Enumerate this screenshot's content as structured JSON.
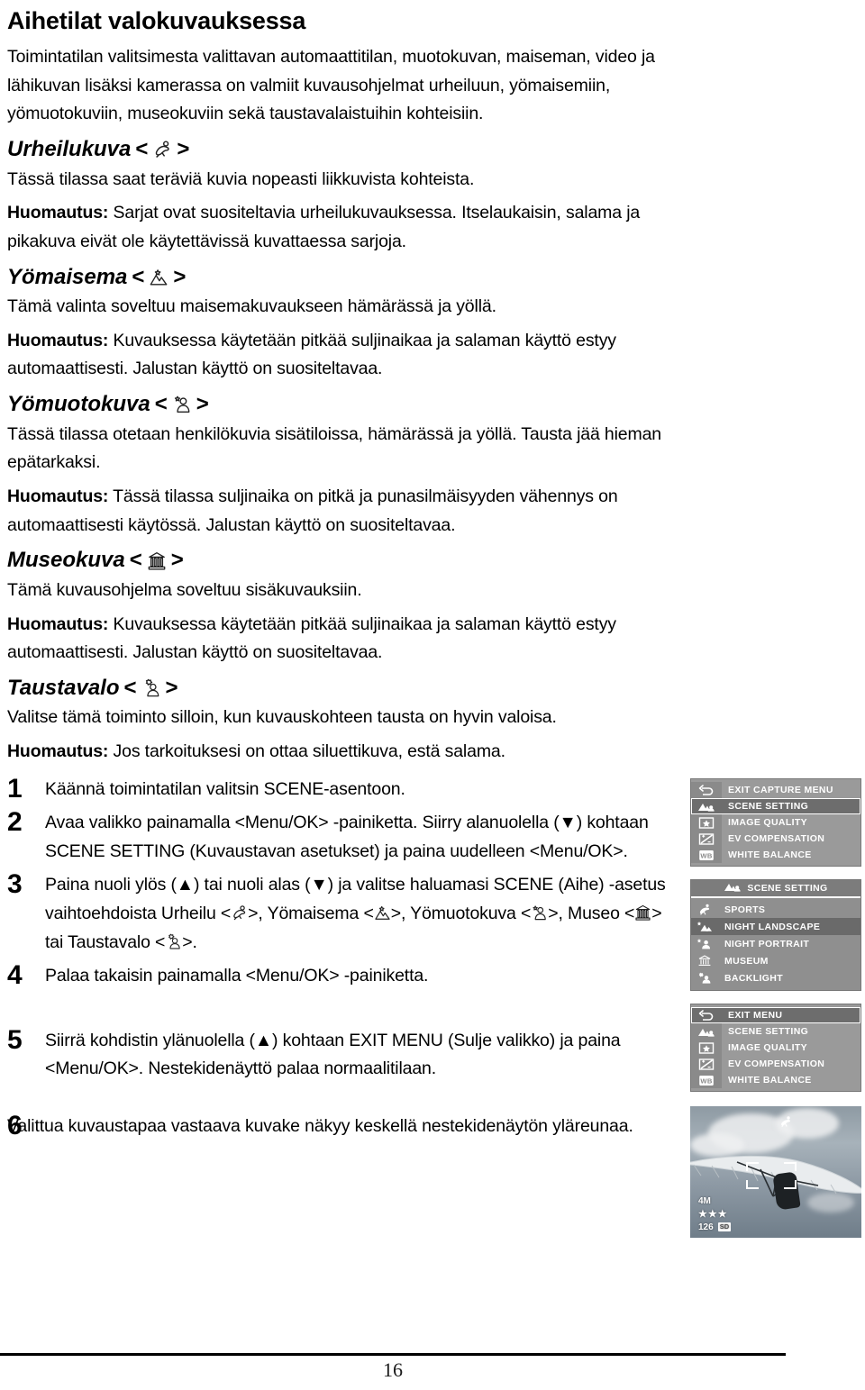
{
  "document": {
    "title": "Aihetilat valokuvauksessa",
    "page_number": "16",
    "intro": "Toimintatilan valitsimesta valittavan automaattitilan, muotokuvan, maiseman, video ja lähikuvan lisäksi kamerassa on valmiit kuvausohjelmat urheiluun, yömaisemiin, yömuotokuviin, museokuviin sekä taustavalaistuihin kohteisiin."
  },
  "sections": [
    {
      "heading": "Urheilukuva",
      "icon": "sports-running-icon",
      "body": "Tässä tilassa saat teräviä kuvia nopeasti liikkuvista kohteista.",
      "note_label": "Huomautus:",
      "note": " Sarjat ovat suositeltavia urheilukuvauksessa.  Itselaukaisin, salama ja pikakuva eivät ole käytettävissä kuvattaessa sarjoja."
    },
    {
      "heading": "Yömaisema",
      "icon": "night-landscape-icon",
      "body": "Tämä valinta soveltuu maisemakuvaukseen hämärässä ja yöllä.",
      "note_label": "Huomautus:",
      "note": " Kuvauksessa käytetään pitkää suljinaikaa ja salaman käyttö estyy automaattisesti. Jalustan käyttö on suositeltavaa."
    },
    {
      "heading": "Yömuotokuva",
      "icon": "night-portrait-icon",
      "body": "Tässä tilassa otetaan henkilökuvia sisätiloissa, hämärässä ja yöllä. Tausta jää hieman epätarkaksi.",
      "note_label": "Huomautus:",
      "note": " Tässä tilassa suljinaika on pitkä ja punasilmäisyyden vähennys on automaattisesti käytössä.  Jalustan käyttö on suositeltavaa."
    },
    {
      "heading": "Museokuva",
      "icon": "museum-icon",
      "body": "Tämä kuvausohjelma soveltuu sisäkuvauksiin.",
      "note_label": "Huomautus:",
      "note": " Kuvauksessa käytetään pitkää suljinaikaa ja salaman käyttö estyy automaattisesti. Jalustan käyttö on suositeltavaa."
    },
    {
      "heading": "Taustavalo",
      "icon": "backlight-icon",
      "body": "Valitse tämä toiminto silloin, kun kuvauskohteen tausta on hyvin valoisa.",
      "note_label": "Huomautus:",
      "note": " Jos tarkoituksesi on ottaa siluettikuva, estä salama."
    }
  ],
  "steps": [
    {
      "number": "1",
      "text": "Käännä toimintatilan valitsin SCENE-asentoon."
    },
    {
      "number": "2",
      "text": "Avaa valikko painamalla <Menu/OK> -painiketta. Siirry alanuolella (▼) kohtaan SCENE SETTING (Kuvaustavan asetukset) ja paina uudelleen <Menu/OK>."
    },
    {
      "number": "3",
      "text_part1": "Paina nuoli ylös (▲) tai nuoli alas (▼) ja valitse haluamasi SCENE (Aihe) -asetus vaihtoehdoista Urheilu <",
      "text_part2": ">, Yömaisema <",
      "text_part3": ">, Yömuotokuva <",
      "text_part4": ">, Museo <",
      "text_part5": "> tai Taustavalo <",
      "text_part6": ">."
    },
    {
      "number": "4",
      "text": "Palaa takaisin painamalla <Menu/OK> -painiketta."
    },
    {
      "number": "5",
      "text": "Siirrä kohdistin ylänuolella (▲) kohtaan EXIT MENU (Sulje valikko) ja paina <Menu/OK>. Nestekidenäyttö palaa normaalitilaan."
    },
    {
      "number": "6",
      "text": "Valittua kuvaustapaa vastaava kuvake näkyy keskellä nestekidenäytön yläreunaa."
    }
  ],
  "lcd_menus": [
    {
      "name": "capture-menu",
      "rows": [
        {
          "icon": "exit-arrow-icon",
          "label": "EXIT CAPTURE MENU",
          "selected": false
        },
        {
          "icon": "scene-setting-icon",
          "label": "SCENE SETTING",
          "selected": true
        },
        {
          "icon": "star-icon",
          "label": "IMAGE QUALITY",
          "selected": false
        },
        {
          "icon": "ev-icon",
          "label": "EV COMPENSATION",
          "selected": false
        },
        {
          "icon": "wb-icon",
          "label": "WHITE BALANCE",
          "selected": false
        }
      ]
    },
    {
      "name": "scene-setting-submenu",
      "header_icon": "scene-setting-icon",
      "header": "SCENE SETTING",
      "rows": [
        {
          "icon": "sports-running-icon",
          "label": "SPORTS",
          "selected": false
        },
        {
          "icon": "night-landscape-icon",
          "label": "NIGHT LANDSCAPE",
          "selected": true
        },
        {
          "icon": "night-portrait-icon",
          "label": "NIGHT PORTRAIT",
          "selected": false
        },
        {
          "icon": "museum-icon",
          "label": "MUSEUM",
          "selected": false
        },
        {
          "icon": "backlight-icon",
          "label": "BACKLIGHT",
          "selected": false
        }
      ]
    },
    {
      "name": "exit-menu",
      "rows": [
        {
          "icon": "exit-arrow-icon",
          "label": "EXIT MENU",
          "selected": true
        },
        {
          "icon": "scene-setting-icon",
          "label": "SCENE SETTING",
          "selected": false
        },
        {
          "icon": "star-icon",
          "label": "IMAGE QUALITY",
          "selected": false
        },
        {
          "icon": "ev-icon",
          "label": "EV COMPENSATION",
          "selected": false
        },
        {
          "icon": "wb-icon",
          "label": "WHITE BALANCE",
          "selected": false
        }
      ]
    }
  ],
  "preview": {
    "name": "lcd-photo-preview",
    "scene_icon": "sports-running-icon",
    "resolution": "4M",
    "quality_stars": "★★★",
    "shots_remaining": "126",
    "card_badge": "SD"
  },
  "colors": {
    "lcd_background": "#9a9a9a",
    "lcd_selected": "#6d6d6d",
    "lcd_text": "#ffffff",
    "page_text": "#000000"
  }
}
